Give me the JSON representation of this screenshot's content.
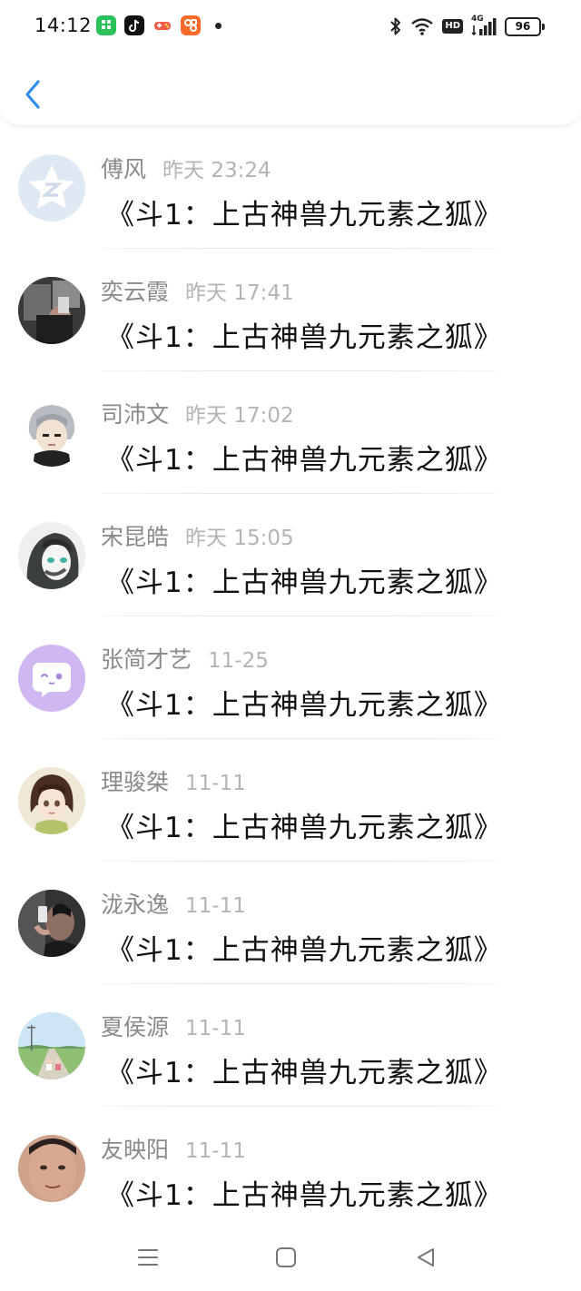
{
  "status_bar": {
    "time": "14:12",
    "battery": "96",
    "network": "4G",
    "hd": "HD"
  },
  "header": {
    "back_icon": "chevron-left-icon",
    "accent_color": "#2f8ff0"
  },
  "messages": [
    {
      "name": "傅风",
      "time": "昨天 23:24",
      "text": "《斗1：上古神兽九元素之狐》",
      "avatar": "qq-star-avatar"
    },
    {
      "name": "奕云霞",
      "time": "昨天 17:41",
      "text": "《斗1：上古神兽九元素之狐》",
      "avatar": "photo-avatar-dark"
    },
    {
      "name": "司沛文",
      "time": "昨天 17:02",
      "text": "《斗1：上古神兽九元素之狐》",
      "avatar": "cartoon-boy-avatar"
    },
    {
      "name": "宋昆皓",
      "time": "昨天 15:05",
      "text": "《斗1：上古神兽九元素之狐》",
      "avatar": "anime-girl-gray-avatar"
    },
    {
      "name": "张简才艺",
      "time": "11-25",
      "text": "《斗1：上古神兽九元素之狐》",
      "avatar": "purple-chat-avatar"
    },
    {
      "name": "理骏桀",
      "time": "11-11",
      "text": "《斗1：上古神兽九元素之狐》",
      "avatar": "anime-girl-avatar"
    },
    {
      "name": "泷永逸",
      "time": "11-11",
      "text": "《斗1：上古神兽九元素之狐》",
      "avatar": "selfie-photo-avatar"
    },
    {
      "name": "夏侯源",
      "time": "11-11",
      "text": "《斗1：上古神兽九元素之狐》",
      "avatar": "landscape-photo-avatar"
    },
    {
      "name": "友映阳",
      "time": "11-11",
      "text": "《斗1：上古神兽九元素之狐》",
      "avatar": "face-photo-avatar"
    }
  ],
  "nav_bar": {
    "buttons": [
      "menu-icon",
      "home-icon",
      "back-triangle-icon"
    ]
  }
}
